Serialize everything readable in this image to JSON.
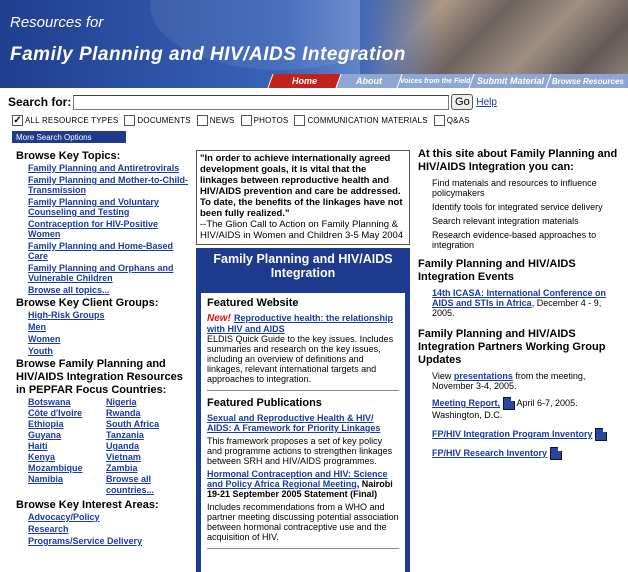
{
  "header": {
    "resources_for": "Resources for",
    "title": "Family Planning and HIV/AIDS Integration"
  },
  "nav": {
    "home": "Home",
    "about": "About",
    "voices": "Voices from the Field",
    "submit": "Submit Material",
    "browse": "Browse Resources"
  },
  "search": {
    "label": "Search for:",
    "value": "",
    "go": "Go",
    "help": "Help",
    "types": [
      {
        "label": "All Resource Types",
        "checked": true
      },
      {
        "label": "Documents",
        "checked": false
      },
      {
        "label": "News",
        "checked": false
      },
      {
        "label": "Photos",
        "checked": false
      },
      {
        "label": "Communication Materials",
        "checked": false
      },
      {
        "label": "Q&As",
        "checked": false
      }
    ],
    "more_options": "More Search Options"
  },
  "left": {
    "topics_heading": "Browse Key Topics:",
    "topics": [
      "Family Planning and Antiretrovirals",
      "Family Planning and Mother-to-Child-Transmission",
      "Family Planning and Voluntary Counseling and Testing",
      "Contraception for HIV-Positive Women",
      "Family Planning and Home-Based Care",
      "Family Planning and Orphans and Vulnerable Children",
      "Browse all topics..."
    ],
    "groups_heading": "Browse Key Client Groups:",
    "groups": [
      "High-Risk Groups",
      "Men",
      "Women",
      "Youth"
    ],
    "countries_heading": "Browse Family Planning and HIV/AIDS Integration Resources in PEPFAR Focus Countries:",
    "countries": [
      "Botswana",
      "Nigeria",
      "Côte d'Ivoire",
      "Rwanda",
      "Ethiopia",
      "South Africa",
      "Guyana",
      "Tanzania",
      "Haiti",
      "Uganda",
      "Kenya",
      "Vietnam",
      "Mozambique",
      "Zambia",
      "Namibia",
      "Browse all countries..."
    ],
    "interest_heading": "Browse Key Interest Areas:",
    "interests": [
      "Advocacy/Policy",
      "Research",
      "Programs/Service Delivery"
    ]
  },
  "quote": {
    "text": "\"In order to achieve internationally agreed development goals, it is vital that the linkages between reproductive health and HIV/AIDS prevention and care be addressed. To date, the benefits of the linkages have not been fully realized.\"",
    "source": "--The Glion Call to Action on Family Planning & HIV/AIDS in Women and Children 3-5 May 2004"
  },
  "center": {
    "panel_title": "Family Planning and HIV/AIDS Integration",
    "featured_website_heading": "Featured Website",
    "new_badge": "New!",
    "website_link": "Reproductive health: the relationship with HIV and AIDS",
    "website_desc": "ELDIS Quick Guide to the key issues. Includes summaries and research on the key issues, including an overview of definitions and linkages, relevant international targets and approaches to integration.",
    "publications_heading": "Featured Publications",
    "pub1_link": "Sexual and Reproductive Health & HIV/ AIDS: A Framework for Priority Linkages",
    "pub1_desc": "This framework proposes a set of key policy and programme actions to strengthen linkages between SRH and HIV/AIDS programmes.",
    "pub2_link": "Hormonal Contraception and HIV: Science and Policy Africa Regional Meeting",
    "pub2_suffix": ", Nairobi 19-21 September 2005 Statement (Final)",
    "pub2_desc": "Includes recommendations from a WHO and partner meeting discussing potential association between hormonal contraceptive use and the acquisition of HIV."
  },
  "right": {
    "about_heading": "At this site about Family Planning and HIV/AIDS Integration you can:",
    "about_items": [
      "Find materials and resources to influence policymakers",
      "Identify tools for integrated service delivery",
      "Search relevant integration materials",
      "Research evidence-based approaches to integration"
    ],
    "events_heading": "Family Planning and HIV/AIDS Integration Events",
    "event_link": "14th ICASA: International Conference on AIDS and STIs in Africa",
    "event_suffix": ", December 4 - 9, 2005.",
    "partners_heading": "Family Planning and HIV/AIDS Integration Partners Working Group Updates",
    "view_prefix": "View ",
    "presentations_link": "presentations",
    "view_suffix": " from the meeting, November 3-4, 2005.",
    "report_link": "Meeting Report,",
    "report_suffix": " April 6-7, 2005. Washington, D.C.",
    "inventory1": "FP/HIV Integration Program Inventory",
    "inventory2": "FP/HIV Research Inventory"
  }
}
